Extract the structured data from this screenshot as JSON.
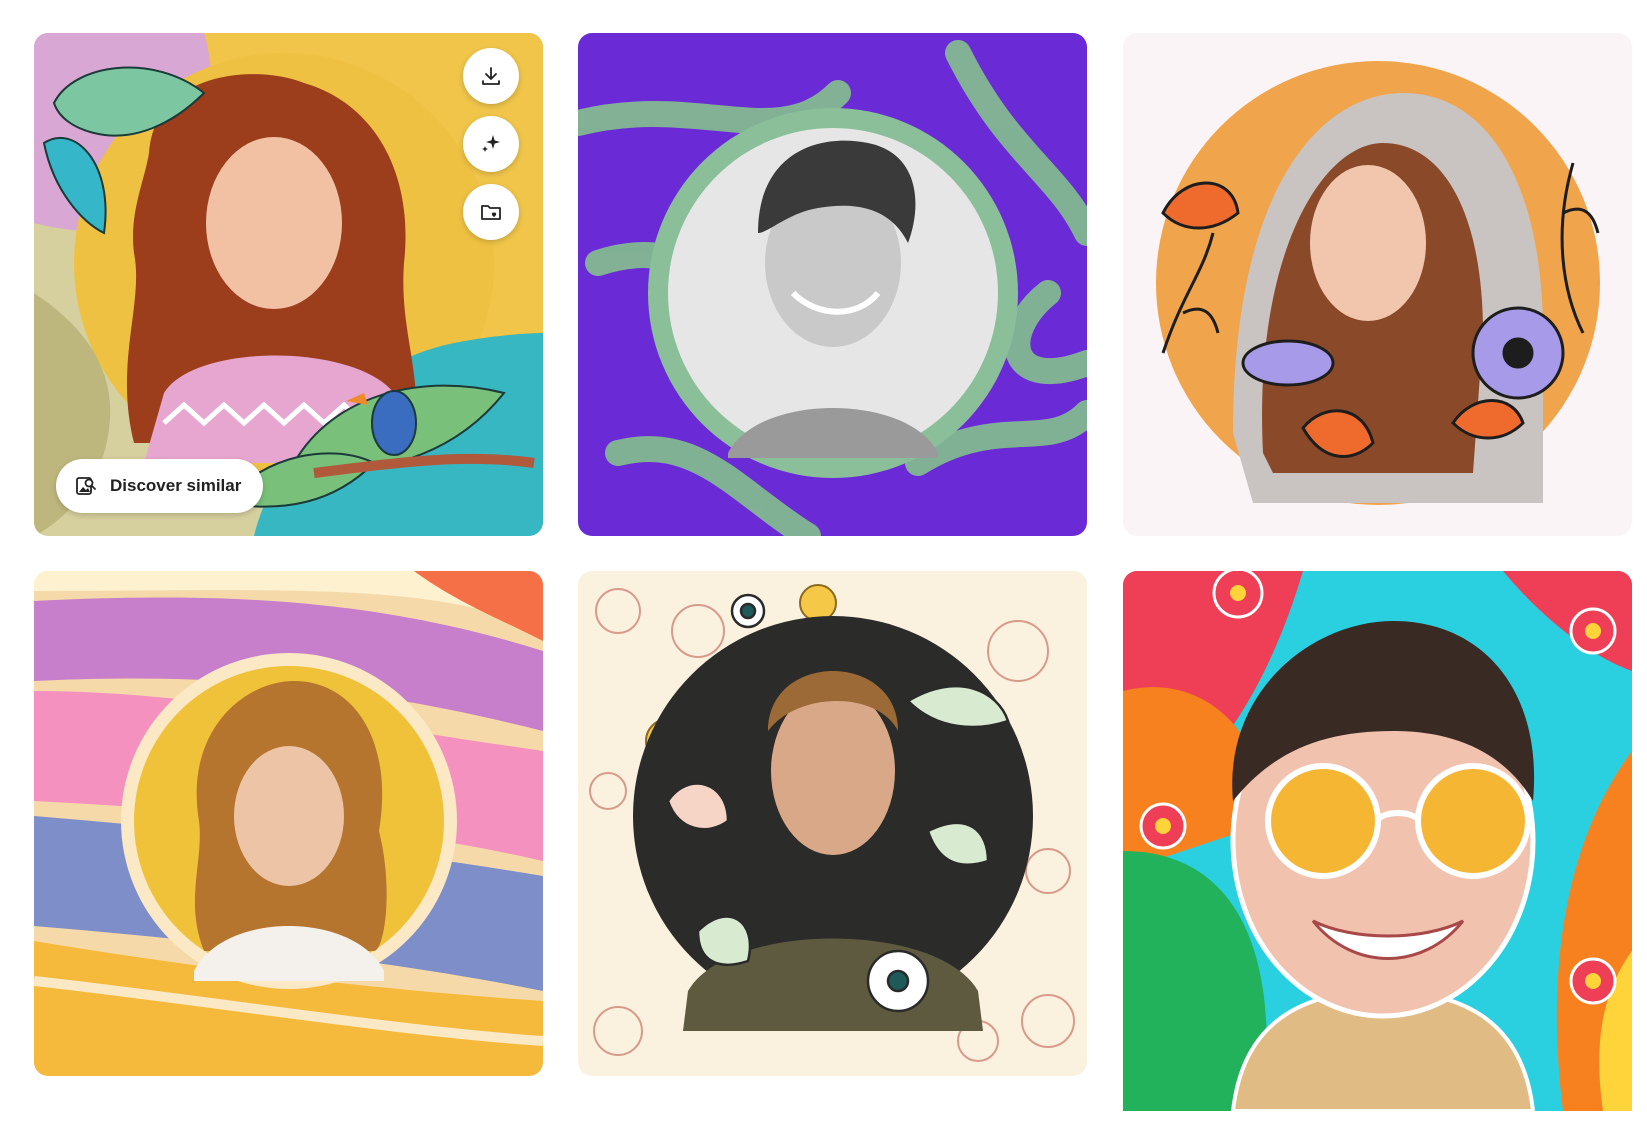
{
  "gallery": {
    "cards": [
      {
        "name": "curly-red-hair-girl-tropical-frame",
        "accent": "#f1c44a"
      },
      {
        "name": "boy-purple-leaf-frame",
        "accent": "#6a2bd6"
      },
      {
        "name": "woman-hood-floral-circle",
        "accent": "#f0a44b"
      },
      {
        "name": "curly-woman-rainbow-wave-frame",
        "accent": "#c97ec9"
      },
      {
        "name": "man-floral-line-art-frame",
        "accent": "#fbf1df"
      },
      {
        "name": "smiling-person-sunglasses-colorful-burst",
        "accent": "#2ad0e0"
      }
    ]
  },
  "card_actions": {
    "download_icon": "download-icon",
    "ai_icon": "sparkle-icon",
    "save_icon": "folder-heart-icon",
    "discover_icon": "image-search-icon",
    "discover_label": "Discover similar"
  }
}
